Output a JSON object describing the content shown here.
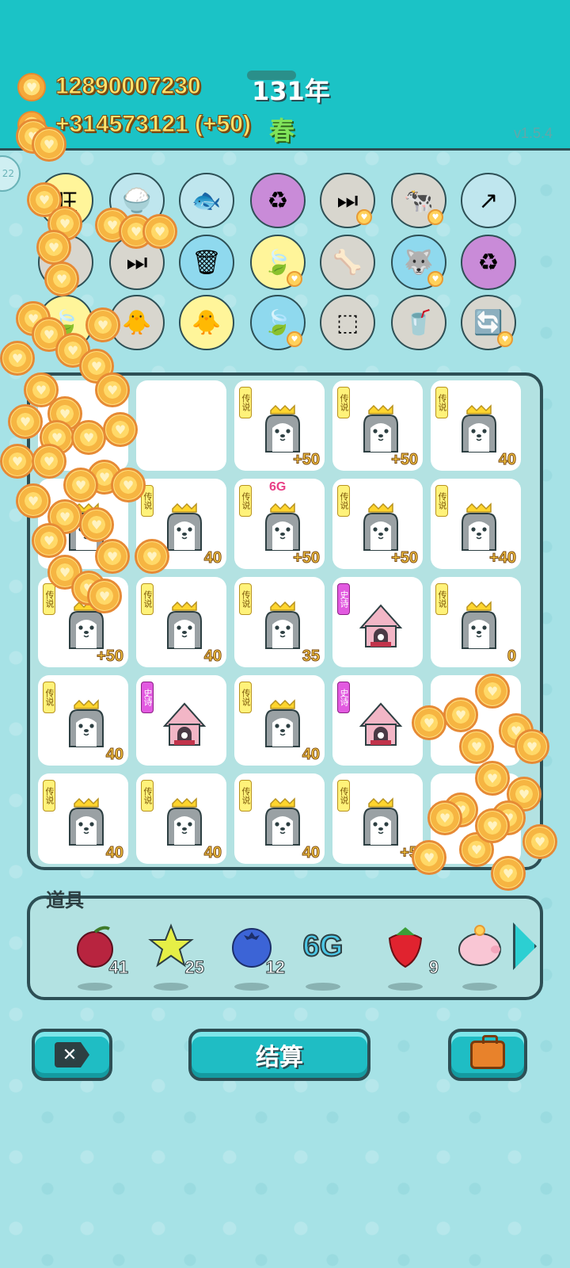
{
  "header": {
    "money": "12890007230",
    "year": "131年",
    "income": "+314573121 (+50)",
    "season": "春",
    "version": "v1.5.4",
    "side_tab": "22"
  },
  "items_row1": [
    "旺",
    "🍚",
    "🐟",
    "♻",
    "⏭",
    "🐄",
    "↗"
  ],
  "items_row2": [
    "",
    "⏭",
    "🗑",
    "🍃",
    "🦴",
    "🐺",
    "♻"
  ],
  "items_row3": [
    "🍃",
    "🐥",
    "🐥",
    "🍃",
    "⬚",
    "🥤",
    "🔄"
  ],
  "board": {
    "tiles": [
      {
        "tag": "",
        "value": "",
        "chip": ""
      },
      {
        "tag": "",
        "value": "",
        "chip": ""
      },
      {
        "tag": "传说",
        "value": "+50",
        "chip": ""
      },
      {
        "tag": "传说",
        "value": "+50",
        "chip": ""
      },
      {
        "tag": "传说",
        "value": "40",
        "chip": ""
      },
      {
        "tag": "",
        "value": "0",
        "chip": ""
      },
      {
        "tag": "传说",
        "value": "40",
        "chip": ""
      },
      {
        "tag": "传说",
        "value": "+50",
        "chip": "6G"
      },
      {
        "tag": "传说",
        "value": "+50",
        "chip": ""
      },
      {
        "tag": "传说",
        "value": "+40",
        "chip": ""
      },
      {
        "tag": "传说",
        "value": "+50",
        "chip": ""
      },
      {
        "tag": "传说",
        "value": "40",
        "chip": ""
      },
      {
        "tag": "传说",
        "value": "35",
        "chip": ""
      },
      {
        "tag": "史诗",
        "value": "",
        "chip": ""
      },
      {
        "tag": "传说",
        "value": "0",
        "chip": ""
      },
      {
        "tag": "传说",
        "value": "40",
        "chip": ""
      },
      {
        "tag": "史诗",
        "value": "",
        "chip": ""
      },
      {
        "tag": "传说",
        "value": "40",
        "chip": ""
      },
      {
        "tag": "史诗",
        "value": "",
        "chip": ""
      },
      {
        "tag": "",
        "value": "",
        "chip": ""
      },
      {
        "tag": "传说",
        "value": "40",
        "chip": ""
      },
      {
        "tag": "传说",
        "value": "40",
        "chip": ""
      },
      {
        "tag": "传说",
        "value": "40",
        "chip": ""
      },
      {
        "tag": "传说",
        "value": "+5",
        "chip": ""
      },
      {
        "tag": "",
        "value": "",
        "chip": ""
      }
    ]
  },
  "props": {
    "label": "道具",
    "items": [
      {
        "icon": "lychee-icon",
        "count": "41"
      },
      {
        "icon": "star-icon",
        "count": "25"
      },
      {
        "icon": "blueberry-icon",
        "count": "12"
      },
      {
        "icon": "6g-icon",
        "count": "",
        "text": "6G"
      },
      {
        "icon": "strawberry-icon",
        "count": "9"
      },
      {
        "icon": "piggy-bank-icon",
        "count": ""
      }
    ]
  },
  "buttons": {
    "settle": "结算"
  }
}
